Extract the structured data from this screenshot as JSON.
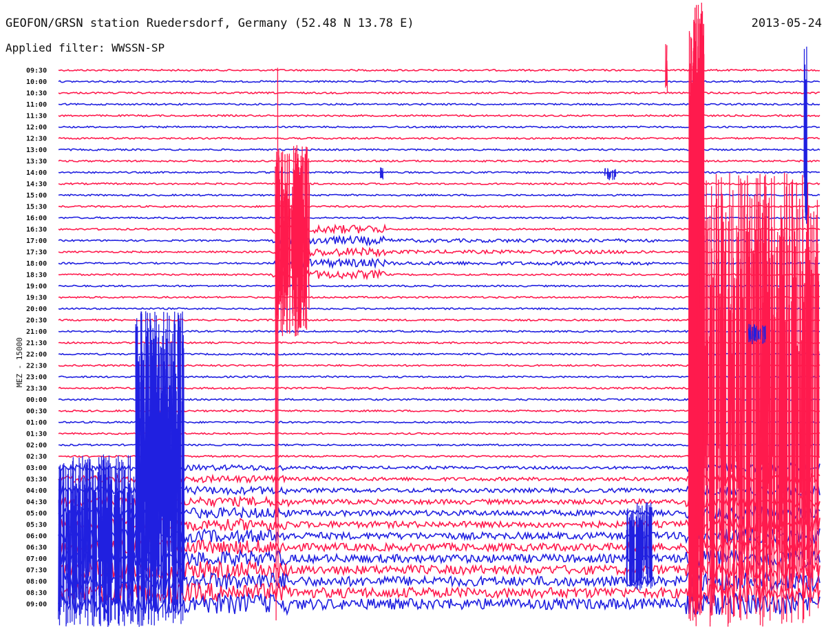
{
  "header": {
    "title": "GEOFON/GRSN station Ruedersdorf, Germany (52.48 N 13.78 E)",
    "date": "2013-05-24",
    "filter": "Applied filter: WWSSN-SP"
  },
  "chart_data": {
    "type": "line",
    "ylabel": "MEZ - 15000",
    "colors": {
      "odd_rows": "#ff1a4d",
      "even_rows": "#2020e0"
    },
    "rows": [
      {
        "label": "09:30",
        "color": "red"
      },
      {
        "label": "10:00",
        "color": "blue"
      },
      {
        "label": "10:30",
        "color": "red"
      },
      {
        "label": "11:00",
        "color": "blue"
      },
      {
        "label": "11:30",
        "color": "red"
      },
      {
        "label": "12:00",
        "color": "blue"
      },
      {
        "label": "12:30",
        "color": "red"
      },
      {
        "label": "13:00",
        "color": "blue"
      },
      {
        "label": "13:30",
        "color": "red"
      },
      {
        "label": "14:00",
        "color": "blue"
      },
      {
        "label": "14:30",
        "color": "red"
      },
      {
        "label": "15:00",
        "color": "blue"
      },
      {
        "label": "15:30",
        "color": "red"
      },
      {
        "label": "16:00",
        "color": "blue"
      },
      {
        "label": "16:30",
        "color": "red"
      },
      {
        "label": "17:00",
        "color": "blue"
      },
      {
        "label": "17:30",
        "color": "red"
      },
      {
        "label": "18:00",
        "color": "blue"
      },
      {
        "label": "18:30",
        "color": "red"
      },
      {
        "label": "19:00",
        "color": "blue"
      },
      {
        "label": "19:30",
        "color": "red"
      },
      {
        "label": "20:00",
        "color": "blue"
      },
      {
        "label": "20:30",
        "color": "red"
      },
      {
        "label": "21:00",
        "color": "blue"
      },
      {
        "label": "21:30",
        "color": "red"
      },
      {
        "label": "22:00",
        "color": "blue"
      },
      {
        "label": "22:30",
        "color": "red"
      },
      {
        "label": "23:00",
        "color": "blue"
      },
      {
        "label": "23:30",
        "color": "red"
      },
      {
        "label": "00:00",
        "color": "blue"
      },
      {
        "label": "00:30",
        "color": "red"
      },
      {
        "label": "01:00",
        "color": "blue"
      },
      {
        "label": "01:30",
        "color": "red"
      },
      {
        "label": "02:00",
        "color": "blue"
      },
      {
        "label": "02:30",
        "color": "red"
      },
      {
        "label": "03:00",
        "color": "blue"
      },
      {
        "label": "03:30",
        "color": "red"
      },
      {
        "label": "04:00",
        "color": "blue"
      },
      {
        "label": "04:30",
        "color": "red"
      },
      {
        "label": "05:00",
        "color": "blue"
      },
      {
        "label": "05:30",
        "color": "red"
      },
      {
        "label": "06:00",
        "color": "blue"
      },
      {
        "label": "06:30",
        "color": "red"
      },
      {
        "label": "07:00",
        "color": "blue"
      },
      {
        "label": "07:30",
        "color": "red"
      },
      {
        "label": "08:00",
        "color": "blue"
      },
      {
        "label": "08:30",
        "color": "red"
      },
      {
        "label": "09:00",
        "color": "blue"
      }
    ]
  }
}
